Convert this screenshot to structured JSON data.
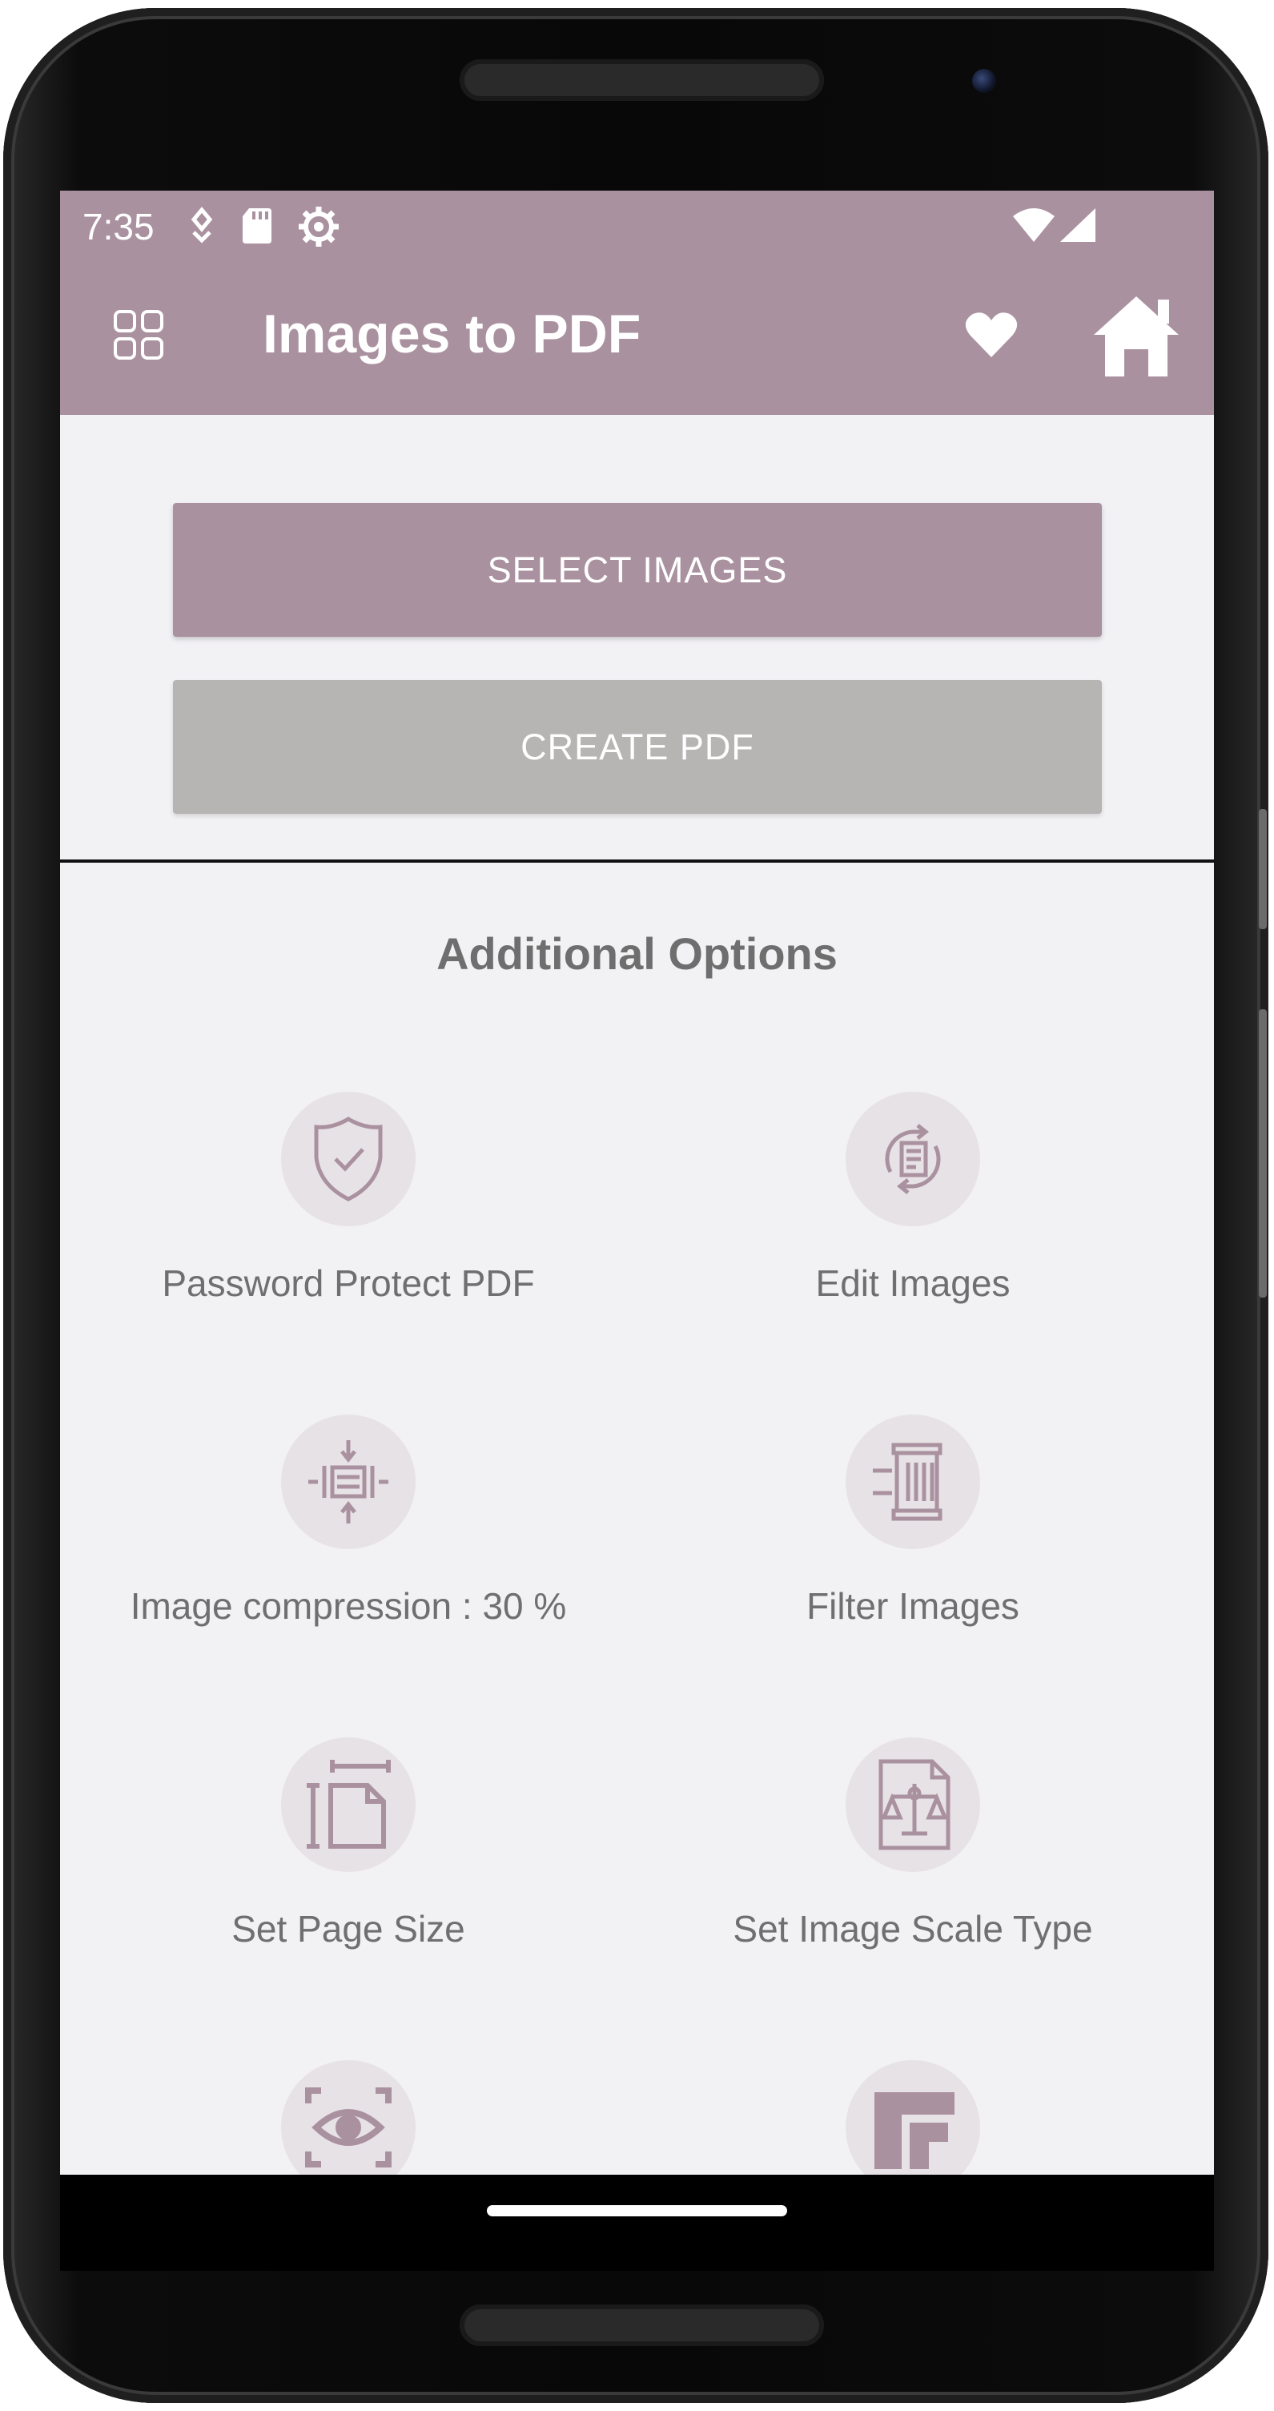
{
  "status_bar": {
    "time": "7:35",
    "icons": [
      "notification-icon",
      "sd-card-icon",
      "settings-gear-icon",
      "wifi-icon",
      "cell-signal-icon"
    ]
  },
  "toolbar": {
    "title": "Images to PDF",
    "icons": [
      "grid-menu-icon",
      "heart-icon",
      "home-icon"
    ]
  },
  "buttons": {
    "select_images": "SELECT IMAGES",
    "create_pdf": "CREATE PDF"
  },
  "additional": {
    "title": "Additional Options",
    "options": [
      {
        "label": "Password Protect PDF",
        "icon": "shield-check-icon"
      },
      {
        "label": "Edit Images",
        "icon": "edit-document-icon"
      },
      {
        "label": "Image compression : 30 %",
        "icon": "compress-icon"
      },
      {
        "label": "Filter Images",
        "icon": "filter-icon"
      },
      {
        "label": "Set Page Size",
        "icon": "page-size-icon"
      },
      {
        "label": "Set Image Scale Type",
        "icon": "scale-document-icon"
      },
      {
        "label": "",
        "icon": "eye-scan-icon"
      },
      {
        "label": "",
        "icon": "margin-icon"
      }
    ]
  },
  "colors": {
    "accent": "#aa919f",
    "disabled_button": "#b7b4b4",
    "background": "#f2f1f4",
    "icon_circle": "#e7e2e6"
  }
}
